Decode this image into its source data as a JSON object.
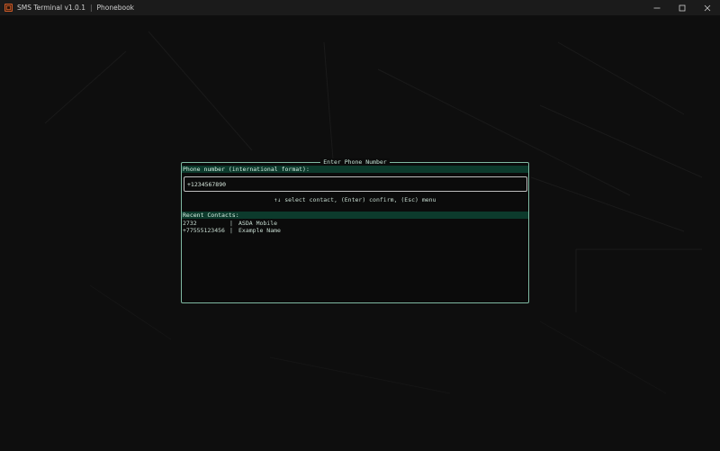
{
  "titlebar": {
    "app_title": "SMS Terminal v1.0.1",
    "separator": "|",
    "section": "Phonebook"
  },
  "dialog": {
    "title": "Enter Phone Number",
    "phone_label": "Phone number (international format):",
    "phone_value": "+1234567890",
    "hint": "↑↓ select contact, (Enter) confirm, (Esc) menu",
    "recent_label": "Recent Contacts:",
    "contacts": [
      {
        "number": "2732",
        "separator": "|",
        "name": "ASDA Mobile"
      },
      {
        "number": "+77555123456",
        "separator": "|",
        "name": "Example Name"
      }
    ]
  },
  "colors": {
    "accent_border": "#7fb9a2",
    "section_bar": "#0c3a2c",
    "background": "#0e0e0e"
  },
  "icons": {
    "app": "app-icon",
    "minimize": "minimize-icon",
    "maximize": "maximize-icon",
    "close": "close-icon"
  }
}
